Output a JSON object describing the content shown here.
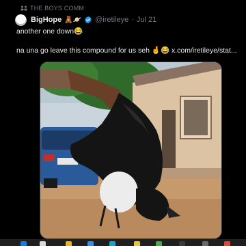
{
  "community": {
    "icon": "community-icon",
    "name": "THE BOYS COMM"
  },
  "post": {
    "author_name": "BigHope",
    "author_emojis": "🧸🪐",
    "verified": true,
    "handle": "@iretileye",
    "separator": "·",
    "date": "Jul 21",
    "text_line1": "another one down😂",
    "text_line2": "na una go leave this compound for us seh 🤞😂",
    "link": "x.com/iretileye/stat..."
  },
  "colors": {
    "background": "#000000",
    "text_primary": "#e7e9ea",
    "text_secondary": "#71767b",
    "verified": "#1d9bf0"
  },
  "taskbar": {
    "icons": [
      "windows-icon",
      "search-icon",
      "folder-icon",
      "store-icon",
      "edge-icon",
      "mail-icon",
      "chrome-icon",
      "terminal-icon",
      "settings-icon",
      "app-icon"
    ]
  }
}
